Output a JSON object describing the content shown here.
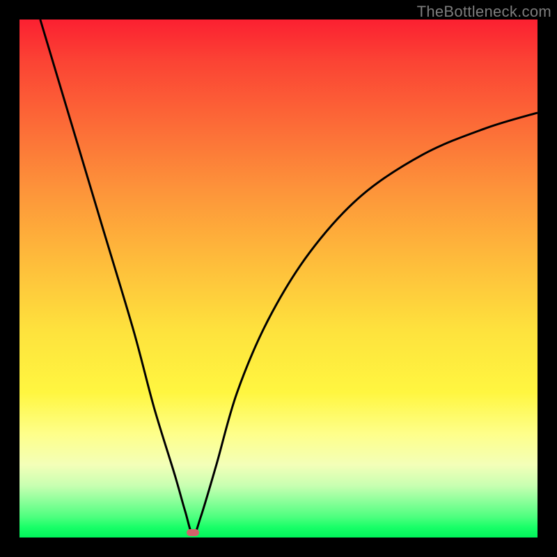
{
  "watermark": "TheBottleneck.com",
  "colors": {
    "curve_stroke": "#000000",
    "marker_fill": "#d2636b"
  },
  "chart_data": {
    "type": "line",
    "title": "",
    "xlabel": "",
    "ylabel": "",
    "xlim": [
      0,
      100
    ],
    "ylim": [
      0,
      100
    ],
    "grid": false,
    "legend": false,
    "series": [
      {
        "name": "bottleneck-curve",
        "x": [
          4,
          10,
          16,
          22,
          26,
          30,
          32,
          33.5,
          35,
          38,
          42,
          48,
          56,
          66,
          78,
          90,
          100
        ],
        "values": [
          100,
          80,
          60,
          40,
          25,
          12,
          5,
          0.5,
          4,
          14,
          28,
          42,
          55,
          66,
          74,
          79,
          82
        ]
      }
    ],
    "marker": {
      "name": "optimum-point",
      "x": 33.5,
      "y": 0.5
    },
    "notes": "Values estimated from pixels. Visual V-shaped curve with minimum near x≈33 at the bottom of the gradient plot area; left branch steep/near-linear, right branch curved and flattens to ~82 at right edge."
  }
}
